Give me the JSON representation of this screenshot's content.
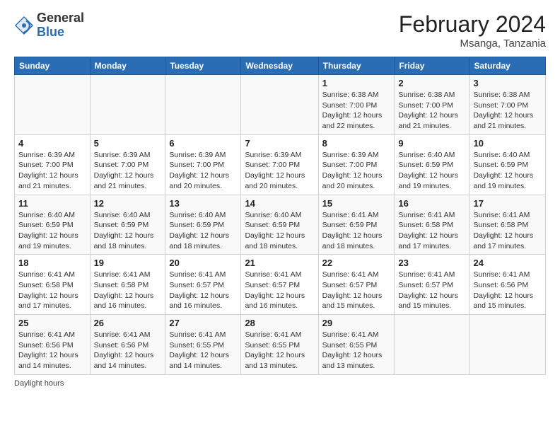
{
  "header": {
    "logo_general": "General",
    "logo_blue": "Blue",
    "title": "February 2024",
    "location": "Msanga, Tanzania"
  },
  "days_of_week": [
    "Sunday",
    "Monday",
    "Tuesday",
    "Wednesday",
    "Thursday",
    "Friday",
    "Saturday"
  ],
  "weeks": [
    [
      {
        "day": "",
        "info": ""
      },
      {
        "day": "",
        "info": ""
      },
      {
        "day": "",
        "info": ""
      },
      {
        "day": "",
        "info": ""
      },
      {
        "day": "1",
        "info": "Sunrise: 6:38 AM\nSunset: 7:00 PM\nDaylight: 12 hours and 22 minutes."
      },
      {
        "day": "2",
        "info": "Sunrise: 6:38 AM\nSunset: 7:00 PM\nDaylight: 12 hours and 21 minutes."
      },
      {
        "day": "3",
        "info": "Sunrise: 6:38 AM\nSunset: 7:00 PM\nDaylight: 12 hours and 21 minutes."
      }
    ],
    [
      {
        "day": "4",
        "info": "Sunrise: 6:39 AM\nSunset: 7:00 PM\nDaylight: 12 hours and 21 minutes."
      },
      {
        "day": "5",
        "info": "Sunrise: 6:39 AM\nSunset: 7:00 PM\nDaylight: 12 hours and 21 minutes."
      },
      {
        "day": "6",
        "info": "Sunrise: 6:39 AM\nSunset: 7:00 PM\nDaylight: 12 hours and 20 minutes."
      },
      {
        "day": "7",
        "info": "Sunrise: 6:39 AM\nSunset: 7:00 PM\nDaylight: 12 hours and 20 minutes."
      },
      {
        "day": "8",
        "info": "Sunrise: 6:39 AM\nSunset: 7:00 PM\nDaylight: 12 hours and 20 minutes."
      },
      {
        "day": "9",
        "info": "Sunrise: 6:40 AM\nSunset: 6:59 PM\nDaylight: 12 hours and 19 minutes."
      },
      {
        "day": "10",
        "info": "Sunrise: 6:40 AM\nSunset: 6:59 PM\nDaylight: 12 hours and 19 minutes."
      }
    ],
    [
      {
        "day": "11",
        "info": "Sunrise: 6:40 AM\nSunset: 6:59 PM\nDaylight: 12 hours and 19 minutes."
      },
      {
        "day": "12",
        "info": "Sunrise: 6:40 AM\nSunset: 6:59 PM\nDaylight: 12 hours and 18 minutes."
      },
      {
        "day": "13",
        "info": "Sunrise: 6:40 AM\nSunset: 6:59 PM\nDaylight: 12 hours and 18 minutes."
      },
      {
        "day": "14",
        "info": "Sunrise: 6:40 AM\nSunset: 6:59 PM\nDaylight: 12 hours and 18 minutes."
      },
      {
        "day": "15",
        "info": "Sunrise: 6:41 AM\nSunset: 6:59 PM\nDaylight: 12 hours and 18 minutes."
      },
      {
        "day": "16",
        "info": "Sunrise: 6:41 AM\nSunset: 6:58 PM\nDaylight: 12 hours and 17 minutes."
      },
      {
        "day": "17",
        "info": "Sunrise: 6:41 AM\nSunset: 6:58 PM\nDaylight: 12 hours and 17 minutes."
      }
    ],
    [
      {
        "day": "18",
        "info": "Sunrise: 6:41 AM\nSunset: 6:58 PM\nDaylight: 12 hours and 17 minutes."
      },
      {
        "day": "19",
        "info": "Sunrise: 6:41 AM\nSunset: 6:58 PM\nDaylight: 12 hours and 16 minutes."
      },
      {
        "day": "20",
        "info": "Sunrise: 6:41 AM\nSunset: 6:57 PM\nDaylight: 12 hours and 16 minutes."
      },
      {
        "day": "21",
        "info": "Sunrise: 6:41 AM\nSunset: 6:57 PM\nDaylight: 12 hours and 16 minutes."
      },
      {
        "day": "22",
        "info": "Sunrise: 6:41 AM\nSunset: 6:57 PM\nDaylight: 12 hours and 15 minutes."
      },
      {
        "day": "23",
        "info": "Sunrise: 6:41 AM\nSunset: 6:57 PM\nDaylight: 12 hours and 15 minutes."
      },
      {
        "day": "24",
        "info": "Sunrise: 6:41 AM\nSunset: 6:56 PM\nDaylight: 12 hours and 15 minutes."
      }
    ],
    [
      {
        "day": "25",
        "info": "Sunrise: 6:41 AM\nSunset: 6:56 PM\nDaylight: 12 hours and 14 minutes."
      },
      {
        "day": "26",
        "info": "Sunrise: 6:41 AM\nSunset: 6:56 PM\nDaylight: 12 hours and 14 minutes."
      },
      {
        "day": "27",
        "info": "Sunrise: 6:41 AM\nSunset: 6:55 PM\nDaylight: 12 hours and 14 minutes."
      },
      {
        "day": "28",
        "info": "Sunrise: 6:41 AM\nSunset: 6:55 PM\nDaylight: 12 hours and 13 minutes."
      },
      {
        "day": "29",
        "info": "Sunrise: 6:41 AM\nSunset: 6:55 PM\nDaylight: 12 hours and 13 minutes."
      },
      {
        "day": "",
        "info": ""
      },
      {
        "day": "",
        "info": ""
      }
    ]
  ],
  "legend": "Daylight hours"
}
